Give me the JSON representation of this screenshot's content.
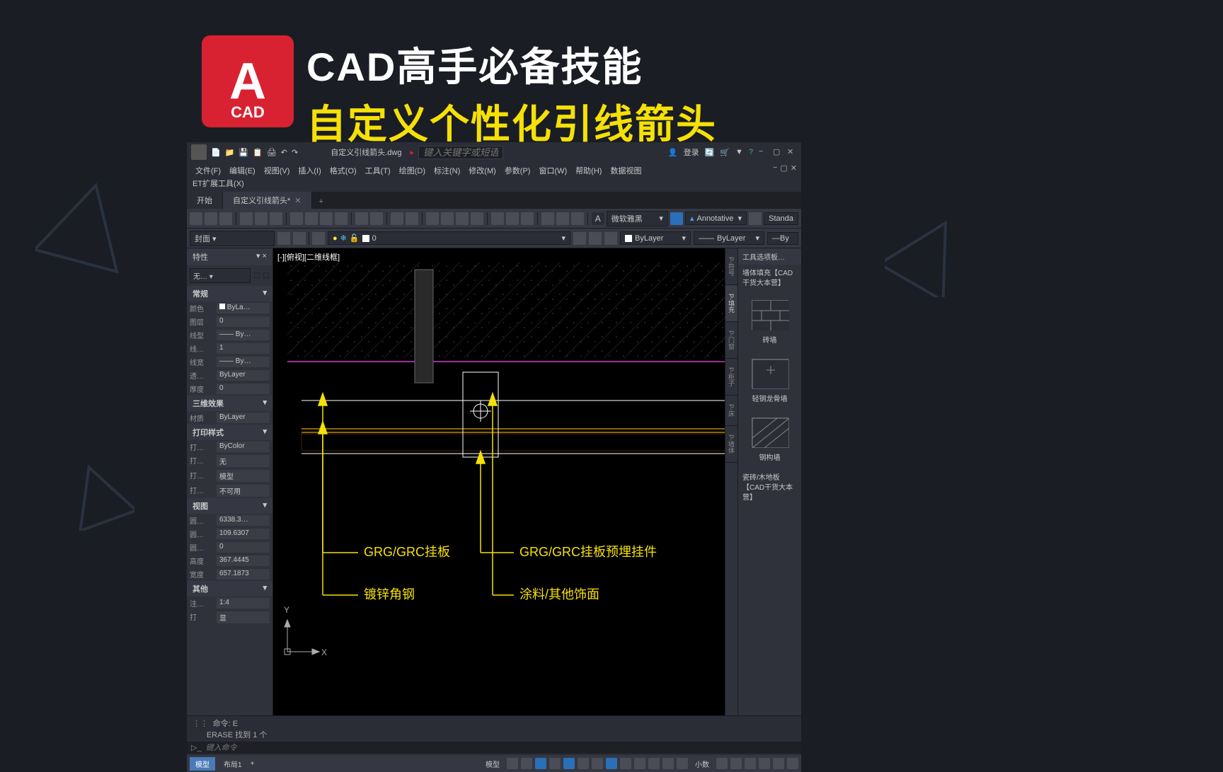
{
  "overlay": {
    "logo_letter": "A",
    "logo_sub": "CAD",
    "line1": "CAD高手必备技能",
    "line2": "自定义个性化引线箭头"
  },
  "titlebar": {
    "doc": "自定义引线箭头.dwg",
    "search_placeholder": "键入关键字或短语",
    "login": "登录"
  },
  "menu": {
    "items": [
      "文件(F)",
      "编辑(E)",
      "视图(V)",
      "插入(I)",
      "格式(O)",
      "工具(T)",
      "绘图(D)",
      "标注(N)",
      "修改(M)",
      "参数(P)",
      "窗口(W)",
      "帮助(H)",
      "数据视图"
    ],
    "line2": "ET扩展工具(X)"
  },
  "tabs": {
    "start": "开始",
    "active": "自定义引线箭头*"
  },
  "toolbar": {
    "font": "微软雅黑",
    "annotative": "Annotative",
    "standard": "Standa"
  },
  "toolbar2": {
    "layer_name": "封面",
    "layer_current": "0",
    "bylayer1": "ByLayer",
    "bylayer2": "ByLayer",
    "bylayer3": "By"
  },
  "props": {
    "title": "特性",
    "selection": "无…",
    "sections": {
      "general": {
        "head": "常规",
        "rows": [
          {
            "lbl": "颜色",
            "val": "ByLa…"
          },
          {
            "lbl": "图层",
            "val": "0"
          },
          {
            "lbl": "线型",
            "val": "—— By…"
          },
          {
            "lbl": "线…",
            "val": "1"
          },
          {
            "lbl": "线宽",
            "val": "—— By…"
          },
          {
            "lbl": "透…",
            "val": "ByLayer"
          },
          {
            "lbl": "厚度",
            "val": "0"
          }
        ]
      },
      "threed": {
        "head": "三维效果",
        "rows": [
          {
            "lbl": "材质",
            "val": "ByLayer"
          }
        ]
      },
      "print": {
        "head": "打印样式",
        "rows": [
          {
            "lbl": "打…",
            "val": "ByColor"
          },
          {
            "lbl": "打…",
            "val": "无"
          },
          {
            "lbl": "打…",
            "val": "模型"
          },
          {
            "lbl": "打…",
            "val": "不可用"
          }
        ]
      },
      "view": {
        "head": "视图",
        "rows": [
          {
            "lbl": "圆…",
            "val": "6338.3…"
          },
          {
            "lbl": "圆…",
            "val": "109.6307"
          },
          {
            "lbl": "圆…",
            "val": "0"
          },
          {
            "lbl": "高度",
            "val": "367.4445"
          },
          {
            "lbl": "宽度",
            "val": "657.1873"
          }
        ]
      },
      "other": {
        "head": "其他",
        "rows": [
          {
            "lbl": "注…",
            "val": "1:4"
          },
          {
            "lbl": "打",
            "val": "显"
          }
        ]
      }
    }
  },
  "canvas": {
    "view_label": "[-][俯视][二维线框]",
    "annotations": {
      "a1": "GRG/GRC挂板",
      "a2": "GRG/GRC挂板预埋挂件",
      "a3": "镀锌角钢",
      "a4": "涂料/其他饰面"
    },
    "axis_y": "Y",
    "axis_x": "X"
  },
  "right_panel": {
    "header": "工具选项板…",
    "subtitle": "墙体填充【CAD干货大本营】",
    "items": [
      "砖墙",
      "轻钢龙骨墙",
      "钢构墙"
    ],
    "footer": "瓷砖/木地板【CAD干货大本营】",
    "vtabs": [
      "P-符号",
      "P-填充",
      "P-门窗",
      "P-柜子",
      "P-床",
      "P-墙体"
    ]
  },
  "cmdline": {
    "history1": "命令: E",
    "history2": "ERASE 找到 1 个",
    "placeholder": "键入命令"
  },
  "statusbar": {
    "model": "模型",
    "layout": "布局1",
    "model2": "模型",
    "decimal": "小数"
  }
}
